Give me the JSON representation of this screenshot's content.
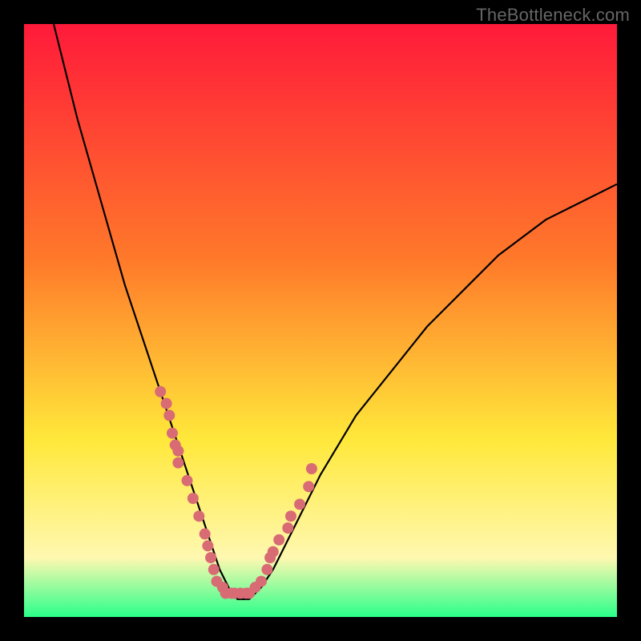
{
  "watermark": "TheBottleneck.com",
  "colors": {
    "gradient_top": "#ff1a3a",
    "gradient_mid1": "#ff7a2a",
    "gradient_mid2": "#ffe83a",
    "gradient_mid3": "#fff8b0",
    "gradient_bottom": "#2aff8a",
    "curve": "#000000",
    "dots": "#d86b74",
    "frame": "#000000"
  },
  "chart_data": {
    "type": "line",
    "title": "",
    "xlabel": "",
    "ylabel": "",
    "xlim": [
      0,
      100
    ],
    "ylim": [
      0,
      100
    ],
    "curve": {
      "x": [
        5,
        7,
        9,
        11,
        13,
        15,
        17,
        19,
        21,
        23,
        25,
        27,
        28,
        29,
        30,
        31,
        32,
        33,
        34,
        35,
        36,
        37,
        38,
        40,
        42,
        44,
        46,
        48,
        50,
        53,
        56,
        60,
        64,
        68,
        72,
        76,
        80,
        84,
        88,
        92,
        96,
        100
      ],
      "y": [
        100,
        92,
        84,
        77,
        70,
        63,
        56,
        50,
        44,
        38,
        32,
        26,
        23,
        20,
        17,
        14,
        11,
        8,
        6,
        4,
        3,
        3,
        3,
        5,
        8,
        12,
        16,
        20,
        24,
        29,
        34,
        39,
        44,
        49,
        53,
        57,
        61,
        64,
        67,
        69,
        71,
        73
      ]
    },
    "dots": {
      "x": [
        23.0,
        24.0,
        24.5,
        25.0,
        25.5,
        26.0,
        26.0,
        27.5,
        28.5,
        29.5,
        30.5,
        31.0,
        31.5,
        32.0,
        32.5,
        33.5,
        34.0,
        35.0,
        35.5,
        36.5,
        37.5,
        38.0,
        39.0,
        40.0,
        41.0,
        41.5,
        42.0,
        43.0,
        44.5,
        45.0,
        46.5,
        48.0,
        48.5
      ],
      "y": [
        38,
        36,
        34,
        31,
        29,
        28,
        26,
        23,
        20,
        17,
        14,
        12,
        10,
        8,
        6,
        5,
        4,
        4,
        4,
        4,
        4,
        4,
        5,
        6,
        8,
        10,
        11,
        13,
        15,
        17,
        19,
        22,
        25
      ]
    },
    "notes": "V-shaped bottleneck curve on a vertical heat gradient (red high → green low). Minimum of curve at roughly x≈36, y≈3. Dots are sampled points along/near the curve around the valley. Values are read visually from pixel positions; no axes or tick labels are rendered in the image."
  }
}
